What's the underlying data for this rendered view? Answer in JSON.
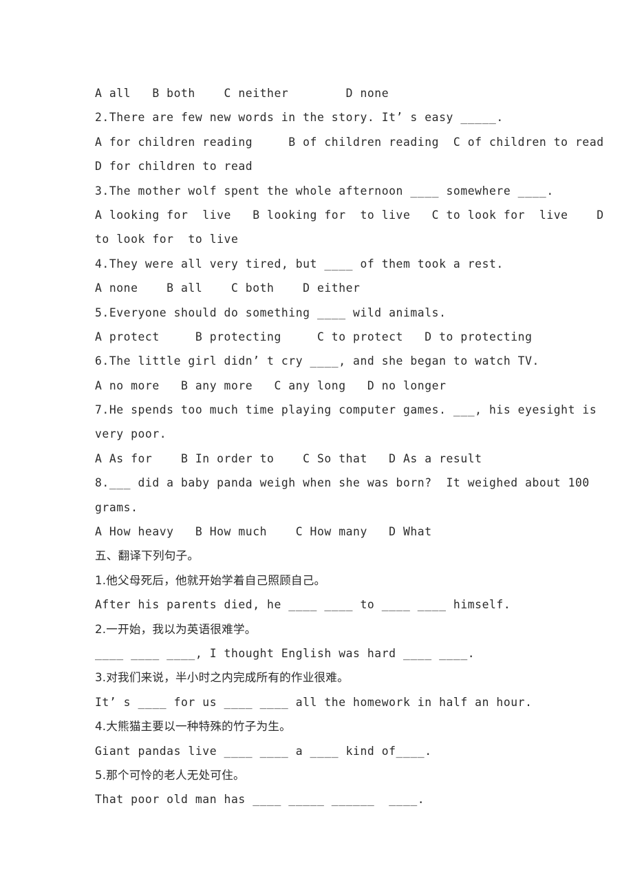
{
  "document": {
    "type": "worksheet",
    "language_mix": [
      "English",
      "Chinese"
    ],
    "background_color": "#ffffff",
    "text_color": "#2b2b2b"
  },
  "lines": [
    {
      "id": "l1",
      "kind": "options",
      "text": "A all   B both    C neither        D none"
    },
    {
      "id": "l2",
      "kind": "question",
      "text": "2.There are few new words in the story. It’ s easy _____."
    },
    {
      "id": "l3",
      "kind": "options",
      "text": "A for children reading     B of children reading  C of children to read"
    },
    {
      "id": "l4",
      "kind": "options",
      "text": "D for children to read"
    },
    {
      "id": "l5",
      "kind": "question",
      "text": "3.The mother wolf spent the whole afternoon ____ somewhere ____."
    },
    {
      "id": "l6",
      "kind": "options",
      "text": "A looking for  live   B looking for  to live   C to look for  live    D"
    },
    {
      "id": "l7",
      "kind": "options",
      "text": "to look for  to live"
    },
    {
      "id": "l8",
      "kind": "question",
      "text": "4.They were all very tired, but ____ of them took a rest."
    },
    {
      "id": "l9",
      "kind": "options",
      "text": "A none    B all    C both    D either"
    },
    {
      "id": "l10",
      "kind": "question",
      "text": "5.Everyone should do something ____ wild animals."
    },
    {
      "id": "l11",
      "kind": "options",
      "text": "A protect     B protecting     C to protect   D to protecting"
    },
    {
      "id": "l12",
      "kind": "question",
      "text": "6.The little girl didn’ t cry ____, and she began to watch TV."
    },
    {
      "id": "l13",
      "kind": "options",
      "text": "A no more   B any more   C any long   D no longer"
    },
    {
      "id": "l14",
      "kind": "question",
      "text": "7.He spends too much time playing computer games. ___, his eyesight is"
    },
    {
      "id": "l15",
      "kind": "question",
      "text": "very poor."
    },
    {
      "id": "l16",
      "kind": "options",
      "text": "A As for    B In order to    C So that   D As a result"
    },
    {
      "id": "l17",
      "kind": "question",
      "text": "8.___ did a baby panda weigh when she was born?  It weighed about 100"
    },
    {
      "id": "l18",
      "kind": "question",
      "text": "grams."
    },
    {
      "id": "l19",
      "kind": "options",
      "text": "A How heavy   B How much    C How many   D What"
    },
    {
      "id": "l20",
      "kind": "section-heading",
      "cjk": true,
      "text": "五、翻译下列句子。"
    },
    {
      "id": "l21",
      "kind": "prompt-cn",
      "cjk": true,
      "text": "1.他父母死后，他就开始学着自己照顾自己。"
    },
    {
      "id": "l22",
      "kind": "answer-en",
      "text": "After his parents died, he ____ ____ to ____ ____ himself."
    },
    {
      "id": "l23",
      "kind": "prompt-cn",
      "cjk": true,
      "text": "2.一开始，我以为英语很难学。"
    },
    {
      "id": "l24",
      "kind": "answer-en",
      "text": "____ ____ ____, I thought English was hard ____ ____."
    },
    {
      "id": "l25",
      "kind": "prompt-cn",
      "cjk": true,
      "text": "3.对我们来说，半小时之内完成所有的作业很难。"
    },
    {
      "id": "l26",
      "kind": "answer-en",
      "text": "It’ s ____ for us ____ ____ all the homework in half an hour."
    },
    {
      "id": "l27",
      "kind": "prompt-cn",
      "cjk": true,
      "text": "4.大熊猫主要以一种特殊的竹子为生。"
    },
    {
      "id": "l28",
      "kind": "answer-en",
      "text": "Giant pandas live ____ ____ a ____ kind of____."
    },
    {
      "id": "l29",
      "kind": "prompt-cn",
      "cjk": true,
      "text": "5.那个可怜的老人无处可住。"
    },
    {
      "id": "l30",
      "kind": "answer-en",
      "text": "That poor old man has ____ _____ ______  ____."
    }
  ]
}
